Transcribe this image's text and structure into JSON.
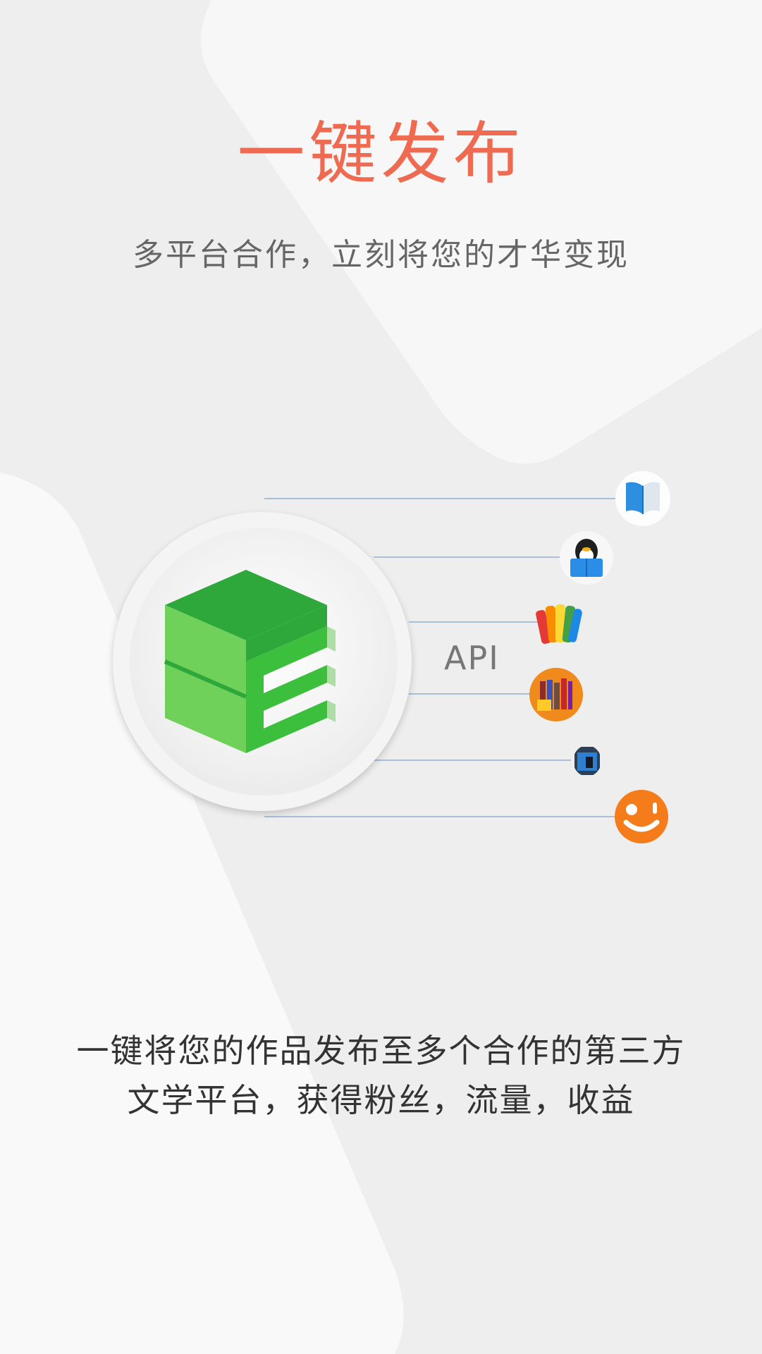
{
  "title": "一键发布",
  "subtitle": "多平台合作，立刻将您的才华变现",
  "api_label": "API",
  "platforms": [
    {
      "icon": "open-book-icon"
    },
    {
      "icon": "qq-reading-icon"
    },
    {
      "icon": "colorful-books-icon"
    },
    {
      "icon": "taobao-books-icon"
    },
    {
      "icon": "reading-app-icon"
    },
    {
      "icon": "orange-smile-icon"
    }
  ],
  "logo_icon": "green-cube-e-logo-icon",
  "description": {
    "line1": "一键将您的作品发布至多个合作的第三方",
    "line2": "文学平台，获得粉丝，流量，收益"
  },
  "colors": {
    "accent": "#ee6a50",
    "logo_green": "#3cb53c",
    "connector": "#a9bfd9"
  }
}
